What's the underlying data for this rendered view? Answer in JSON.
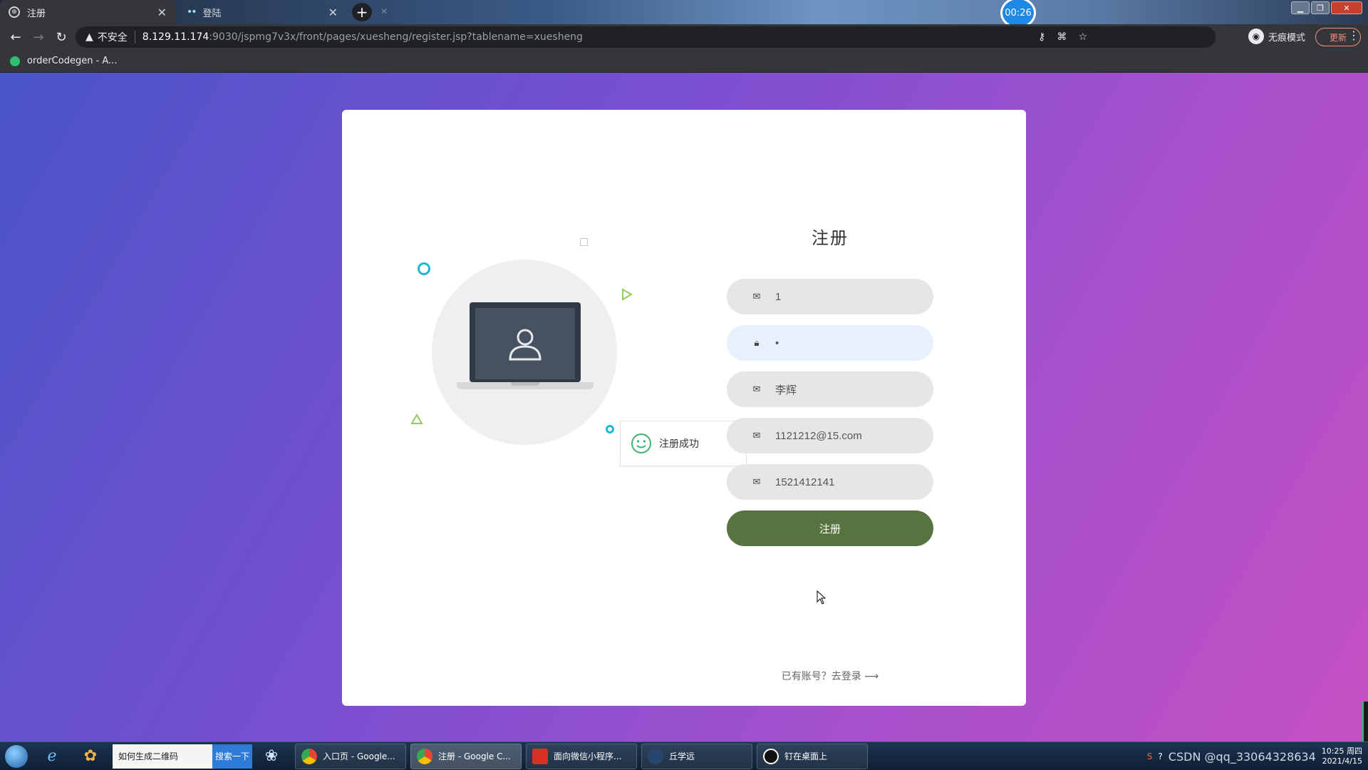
{
  "browser": {
    "tabs": [
      {
        "label": "注册",
        "active": true
      },
      {
        "label": "登陆",
        "active": false
      }
    ],
    "timer": "00:26",
    "address": {
      "warning": "不安全",
      "host": "8.129.11.174",
      "path": ":9030/jspmg7v3x/front/pages/xuesheng/register.jsp?tablename=xuesheng"
    },
    "incognito_label": "无痕模式",
    "update_label": "更新",
    "bookmark": "orderCodegen - A..."
  },
  "page": {
    "title": "注册",
    "fields": [
      {
        "icon": "envelope-icon",
        "value": "1",
        "type": "text"
      },
      {
        "icon": "lock-icon",
        "value": "•",
        "type": "password"
      },
      {
        "icon": "envelope-icon",
        "value": "李辉",
        "type": "text"
      },
      {
        "icon": "envelope-icon",
        "value": "1121212@15.com",
        "type": "text"
      },
      {
        "icon": "envelope-icon",
        "value": "1521412141",
        "type": "text"
      }
    ],
    "submit_label": "注册",
    "login_link": "已有账号？去登录 ⟶",
    "toast": "注册成功",
    "colors": {
      "submit": "#57733f",
      "accent_ring": "#1fb6d0",
      "accent_green": "#8fce5a"
    }
  },
  "taskbar": {
    "search_text": "如何生成二维码",
    "search_button": "搜索一下",
    "tasks": [
      {
        "label": "入口页 - Google...",
        "active": false
      },
      {
        "label": "注册 - Google C...",
        "active": true
      },
      {
        "label": "面向微信小程序...",
        "active": false
      },
      {
        "label": "丘学远",
        "active": false
      },
      {
        "label": "钉在桌面上",
        "active": false
      }
    ],
    "tray_text": "CSDN @qq_33064328634",
    "clock_time": "10:25 周四",
    "clock_date": "2021/4/15"
  }
}
